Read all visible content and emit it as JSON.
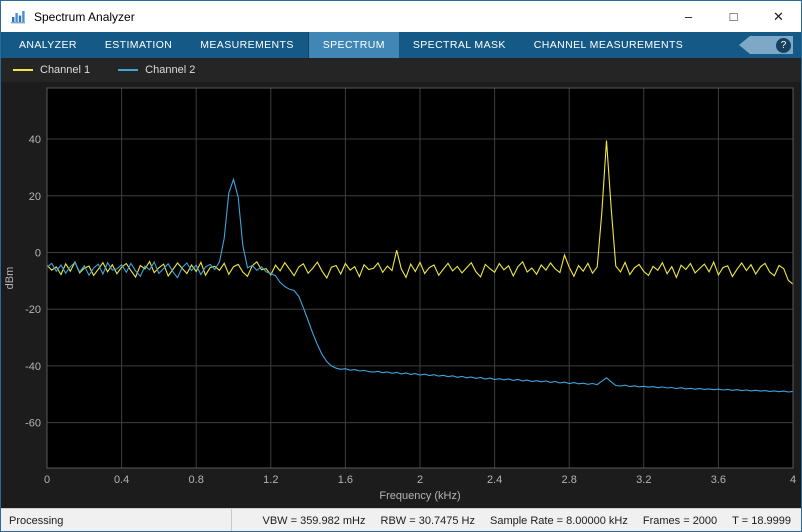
{
  "window": {
    "title": "Spectrum Analyzer",
    "border_color": "#2a6a9b",
    "controls": {
      "minimize": "–",
      "maximize": "□",
      "close": "✕"
    }
  },
  "toolstrip": {
    "bar_color": "#155a87",
    "active_tab_color": "#4187b5",
    "help_label": "?",
    "tabs": [
      {
        "label": "ANALYZER",
        "active": false,
        "group_start": false
      },
      {
        "label": "ESTIMATION",
        "active": false,
        "group_start": false
      },
      {
        "label": "MEASUREMENTS",
        "active": false,
        "group_start": false
      },
      {
        "label": "SPECTRUM",
        "active": true,
        "group_start": true
      },
      {
        "label": "SPECTRAL MASK",
        "active": false,
        "group_start": false
      },
      {
        "label": "CHANNEL MEASUREMENTS",
        "active": false,
        "group_start": false
      }
    ]
  },
  "legend": {
    "items": [
      {
        "label": "Channel 1",
        "color": "#f0e93c"
      },
      {
        "label": "Channel 2",
        "color": "#3fa3dc"
      }
    ]
  },
  "status_bar": {
    "left": "Processing",
    "metrics": [
      "VBW = 359.982 mHz",
      "RBW = 30.7475 Hz",
      "Sample Rate = 8.00000 kHz",
      "Frames = 2000",
      "T = 18.9999"
    ]
  },
  "chart_data": {
    "type": "line",
    "title": "",
    "xlabel": "Frequency (kHz)",
    "ylabel": "dBm",
    "xlim": [
      0,
      4
    ],
    "ylim": [
      -76,
      58
    ],
    "x_ticks": [
      0,
      0.4,
      0.8,
      1.2,
      1.6,
      2,
      2.4,
      2.8,
      3.2,
      3.6,
      4
    ],
    "x_tick_labels": [
      "0",
      "0.4",
      "0.8",
      "1.2",
      "1.6",
      "2",
      "2.4",
      "2.8",
      "3.2",
      "3.6",
      "4"
    ],
    "y_ticks": [
      -60,
      -40,
      -20,
      0,
      20,
      40
    ],
    "grid": true,
    "legend_position": "top-left-strip",
    "background": "#000000",
    "grid_color": "#3e3e3e",
    "axis_color": "#5a5a5a",
    "tick_color": "#b4b4b4",
    "x_spacing": "uniform-over-xlim",
    "series": [
      {
        "name": "Channel 1",
        "color": "#f0e93c",
        "values": [
          -4.5,
          -6.2,
          -5.1,
          -7.8,
          -4.0,
          -6.6,
          -3.4,
          -7.2,
          -5.5,
          -4.8,
          -8.1,
          -5.9,
          -3.6,
          -6.8,
          -4.3,
          -7.5,
          -5.2,
          -3.9,
          -6.4,
          -8.7,
          -4.6,
          -5.8,
          -3.2,
          -7.1,
          -5.4,
          -4.1,
          -8.3,
          -6.0,
          -3.7,
          -5.6,
          -7.4,
          -4.4,
          -6.7,
          -3.5,
          -8.0,
          -5.3,
          -4.9,
          -6.3,
          -3.8,
          -7.7,
          -5.0,
          -4.2,
          -6.9,
          -8.4,
          -4.7,
          -3.3,
          -6.1,
          -5.7,
          -7.9,
          -4.5,
          -6.5,
          -3.6,
          -5.9,
          -8.2,
          -5.1,
          -4.0,
          -7.3,
          -5.5,
          -3.4,
          -6.6,
          -9.0,
          -5.2,
          -4.6,
          -7.6,
          -3.9,
          -6.2,
          -5.0,
          -8.5,
          -4.3,
          -6.0,
          -5.6,
          -3.7,
          -7.0,
          -4.8,
          -6.4,
          0.8,
          -5.8,
          -8.8,
          -4.1,
          -6.7,
          -3.5,
          -7.4,
          -5.3,
          -4.4,
          -8.0,
          -5.9,
          -3.8,
          -6.5,
          -4.9,
          -7.2,
          -5.4,
          -3.6,
          -6.8,
          -8.6,
          -4.2,
          -5.7,
          -7.0,
          -3.9,
          -6.1,
          -4.7,
          -8.3,
          -5.0,
          -3.3,
          -6.9,
          -5.5,
          -7.7,
          -4.4,
          -6.2,
          -3.7,
          -5.8,
          -7.1,
          -0.9,
          -5.2,
          -8.4,
          -4.6,
          -6.6,
          -3.8,
          -7.3,
          -5.1,
          14.0,
          39.5,
          15.5,
          -4.8,
          -6.9,
          -3.5,
          -7.8,
          -5.4,
          -4.2,
          -6.7,
          -8.1,
          -4.9,
          -6.3,
          -3.6,
          -7.5,
          -5.0,
          -8.8,
          -4.5,
          -6.0,
          -3.9,
          -7.2,
          -5.6,
          -4.1,
          -6.8,
          -3.4,
          -7.9,
          -5.3,
          -4.7,
          -8.5,
          -5.9,
          -3.7,
          -6.4,
          -4.3,
          -7.6,
          -5.1,
          -3.8,
          -6.9,
          -8.2,
          -4.6,
          -5.7,
          -9.8,
          -11.2
        ]
      },
      {
        "name": "Channel 2",
        "color": "#3fa3dc",
        "values": [
          -5.2,
          -3.8,
          -6.6,
          -4.4,
          -7.3,
          -5.0,
          -3.5,
          -6.9,
          -4.7,
          -8.0,
          -5.5,
          -4.1,
          -7.6,
          -3.6,
          -6.2,
          -5.8,
          -4.3,
          -7.0,
          -3.9,
          -6.5,
          -8.4,
          -4.8,
          -6.1,
          -3.4,
          -7.4,
          -5.6,
          -4.0,
          -6.8,
          -8.9,
          -5.3,
          -3.7,
          -6.4,
          -4.5,
          -7.8,
          -5.1,
          -4.2,
          -6.0,
          -3.3,
          5.0,
          21.0,
          25.8,
          19.5,
          2.5,
          -5.4,
          -4.6,
          -6.3,
          -5.0,
          -6.8,
          -7.4,
          -8.2,
          -10.5,
          -12.0,
          -13.0,
          -13.4,
          -15.5,
          -19.5,
          -24.0,
          -28.5,
          -32.5,
          -36.0,
          -38.5,
          -40.0,
          -40.8,
          -41.2,
          -41.0,
          -41.5,
          -41.3,
          -41.8,
          -41.6,
          -42.0,
          -42.2,
          -41.9,
          -42.4,
          -42.1,
          -42.6,
          -42.3,
          -42.8,
          -42.5,
          -43.0,
          -42.7,
          -43.2,
          -42.9,
          -43.4,
          -43.1,
          -43.6,
          -43.3,
          -43.8,
          -43.5,
          -44.0,
          -43.7,
          -44.2,
          -43.9,
          -44.4,
          -44.1,
          -44.6,
          -44.3,
          -44.8,
          -44.5,
          -44.9,
          -44.6,
          -45.1,
          -44.8,
          -45.3,
          -45.0,
          -45.5,
          -45.2,
          -45.6,
          -45.3,
          -45.8,
          -45.5,
          -46.0,
          -45.7,
          -46.2,
          -45.9,
          -46.3,
          -46.1,
          -46.5,
          -46.2,
          -46.6,
          -45.4,
          -44.2,
          -45.6,
          -46.9,
          -47.1,
          -46.8,
          -47.3,
          -47.0,
          -47.4,
          -47.2,
          -47.5,
          -47.3,
          -47.7,
          -47.4,
          -47.8,
          -47.6,
          -48.0,
          -47.7,
          -48.1,
          -47.9,
          -48.2,
          -48.0,
          -48.3,
          -48.1,
          -48.4,
          -48.2,
          -48.5,
          -48.3,
          -48.6,
          -48.4,
          -48.7,
          -48.5,
          -48.8,
          -48.6,
          -48.9,
          -48.7,
          -49.0,
          -48.8,
          -49.1,
          -48.9,
          -49.2,
          -49.0
        ]
      }
    ]
  }
}
